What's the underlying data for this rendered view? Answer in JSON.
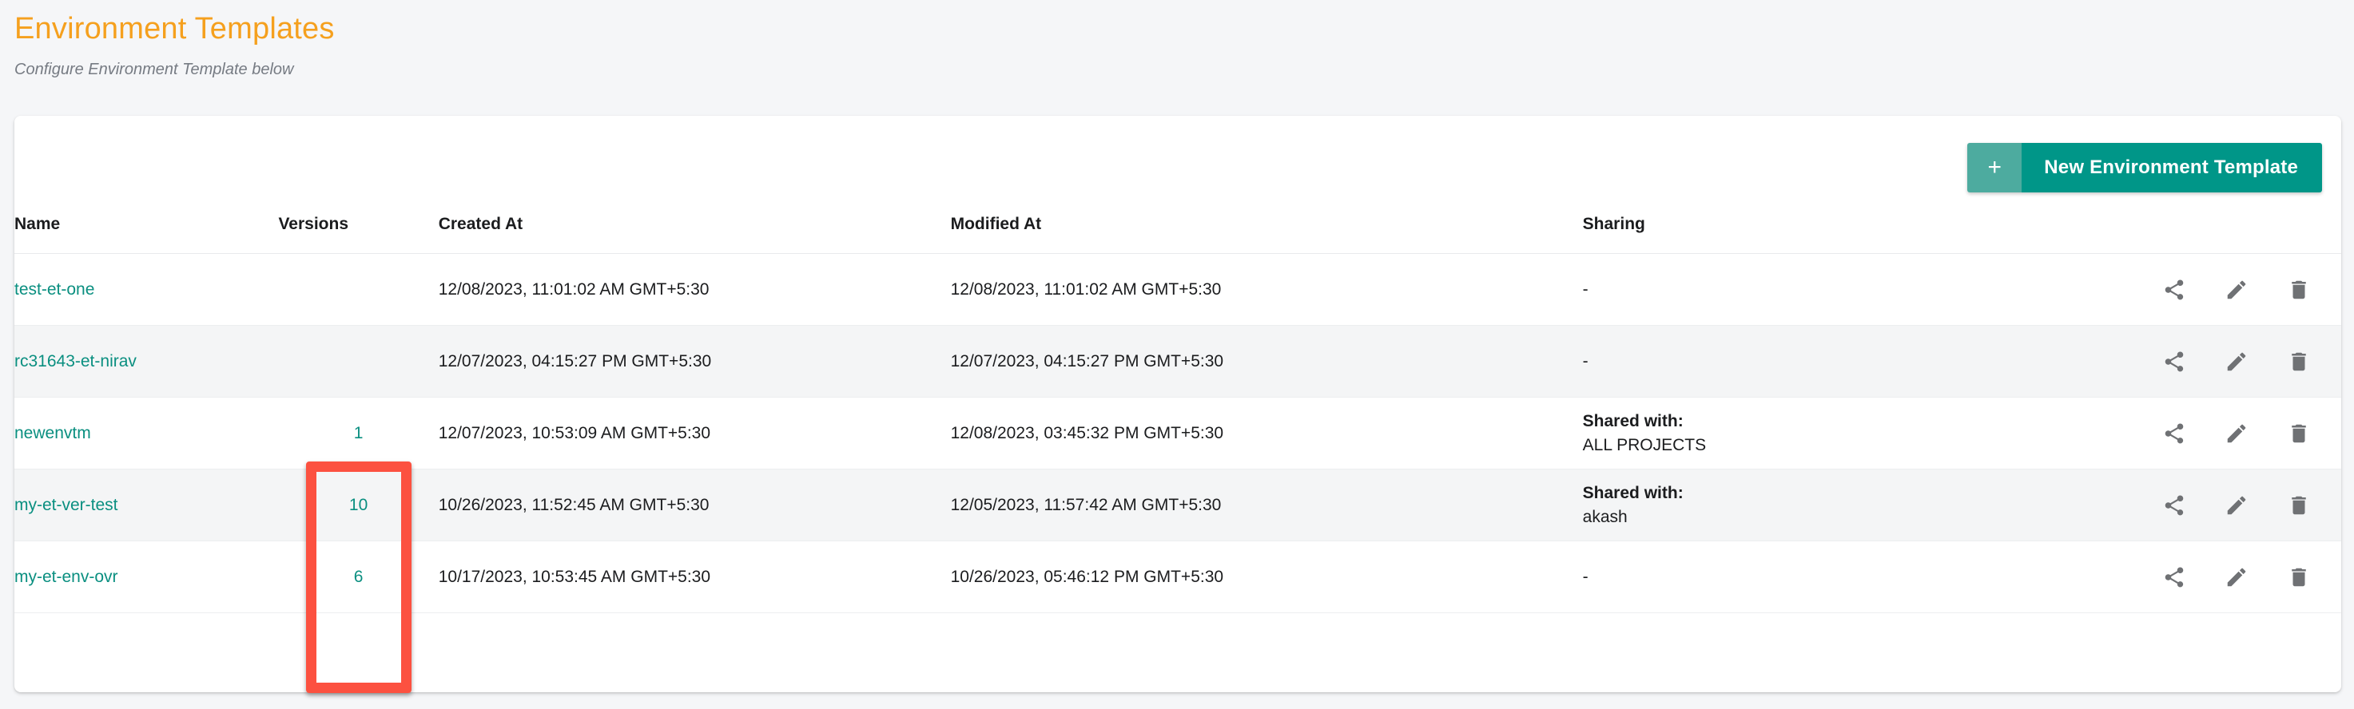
{
  "header": {
    "title": "Environment Templates",
    "subtitle": "Configure Environment Template below",
    "title_color": "#f5a01e"
  },
  "toolbar": {
    "new_button_plus": "+",
    "new_button_label": "New Environment Template",
    "button_color": "#009688",
    "button_plus_color": "#4dab9f"
  },
  "table": {
    "columns": [
      {
        "key": "name",
        "label": "Name"
      },
      {
        "key": "versions",
        "label": "Versions"
      },
      {
        "key": "created_at",
        "label": "Created At"
      },
      {
        "key": "modified_at",
        "label": "Modified At"
      },
      {
        "key": "sharing",
        "label": "Sharing"
      },
      {
        "key": "actions",
        "label": ""
      }
    ],
    "link_color": "#0a8f80",
    "rows": [
      {
        "name": "test-et-one",
        "versions": "",
        "created_at": "12/08/2023, 11:01:02 AM GMT+5:30",
        "modified_at": "12/08/2023, 11:01:02 AM GMT+5:30",
        "sharing_label": "",
        "sharing_value": "-"
      },
      {
        "name": "rc31643-et-nirav",
        "versions": "",
        "created_at": "12/07/2023, 04:15:27 PM GMT+5:30",
        "modified_at": "12/07/2023, 04:15:27 PM GMT+5:30",
        "sharing_label": "",
        "sharing_value": "-"
      },
      {
        "name": "newenvtm",
        "versions": "1",
        "created_at": "12/07/2023, 10:53:09 AM GMT+5:30",
        "modified_at": "12/08/2023, 03:45:32 PM GMT+5:30",
        "sharing_label": "Shared with:",
        "sharing_value": "ALL PROJECTS"
      },
      {
        "name": "my-et-ver-test",
        "versions": "10",
        "created_at": "10/26/2023, 11:52:45 AM GMT+5:30",
        "modified_at": "12/05/2023, 11:57:42 AM GMT+5:30",
        "sharing_label": "Shared with:",
        "sharing_value": "akash"
      },
      {
        "name": "my-et-env-ovr",
        "versions": "6",
        "created_at": "10/17/2023, 10:53:45 AM GMT+5:30",
        "modified_at": "10/26/2023, 05:46:12 PM GMT+5:30",
        "sharing_label": "",
        "sharing_value": "-"
      }
    ],
    "row_actions": [
      {
        "name": "share-icon"
      },
      {
        "name": "edit-icon"
      },
      {
        "name": "delete-icon"
      }
    ]
  },
  "annotation": {
    "color": "#fc5140",
    "target": "versions-column"
  }
}
